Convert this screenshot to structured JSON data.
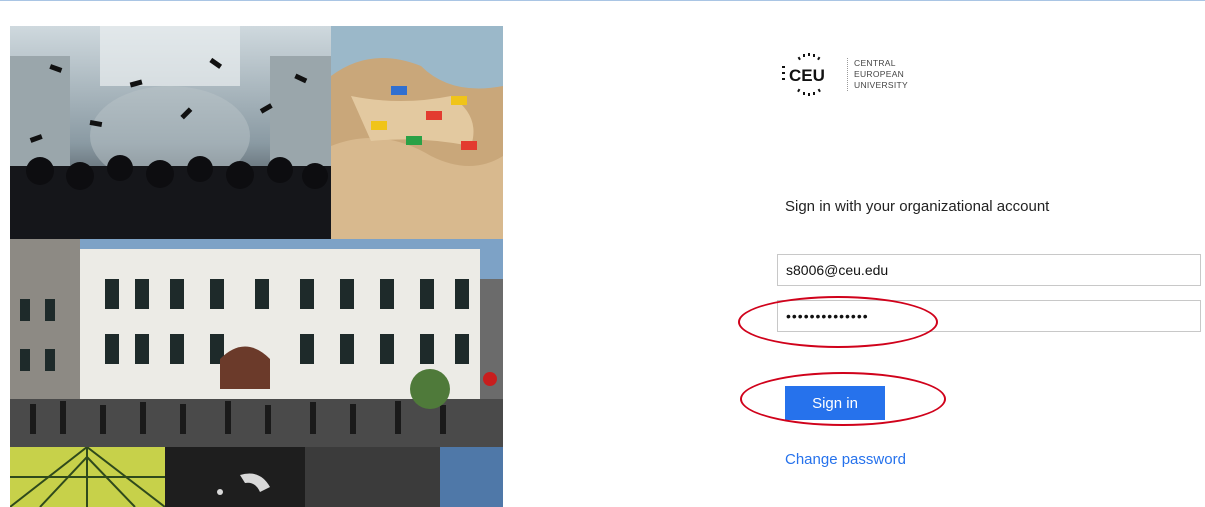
{
  "logo": {
    "acronym": "CEU",
    "line1": "CENTRAL",
    "line2": "EUROPEAN",
    "line3": "UNIVERSITY",
    "brand_color": "#111111"
  },
  "form": {
    "heading": "Sign in with your organizational account",
    "username_value": "s8006@ceu.edu",
    "password_value": "••••••••••••••",
    "signin_label": "Sign in",
    "change_password_label": "Change password"
  },
  "colors": {
    "accent": "#2672ec",
    "annotation": "#d0021b"
  },
  "icons": {
    "logo_mark": "ceu-dots-logo-icon"
  }
}
